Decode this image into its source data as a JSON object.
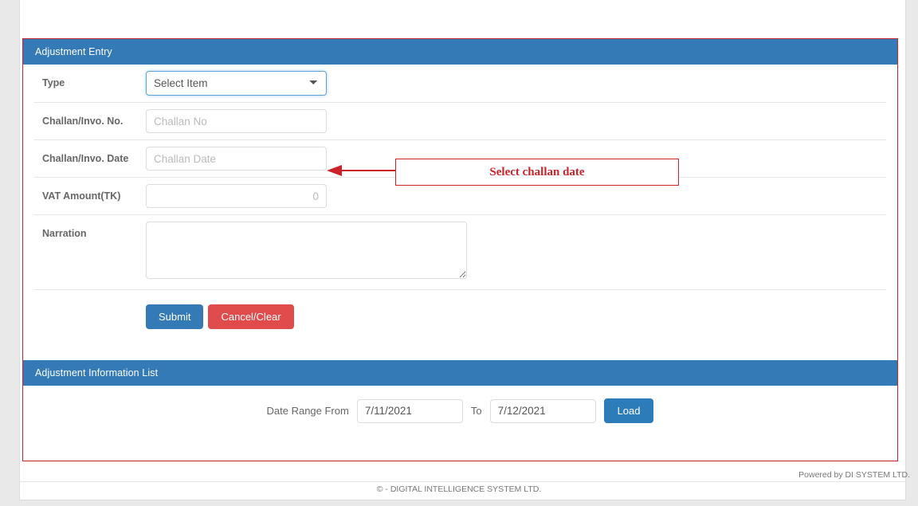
{
  "entry_panel": {
    "title": "Adjustment Entry",
    "fields": [
      {
        "label": "Type",
        "control": "select",
        "value": "Select Item",
        "icon": "chevron-down-icon"
      },
      {
        "label": "Challan/Invo. No.",
        "control": "text",
        "value": "",
        "placeholder": "Challan No"
      },
      {
        "label": "Challan/Invo. Date",
        "control": "text",
        "value": "",
        "placeholder": "Challan Date"
      },
      {
        "label": "VAT Amount(TK)",
        "control": "number",
        "value": "",
        "placeholder": "0"
      },
      {
        "label": "Narration",
        "control": "textarea",
        "value": "",
        "placeholder": ""
      }
    ],
    "submit_label": "Submit",
    "cancel_label": "Cancel/Clear"
  },
  "annotation": {
    "text": "Select challan date",
    "color": "#cc2229",
    "arrow": "arrow-left-icon"
  },
  "list_panel": {
    "title": "Adjustment Information List",
    "from_label": "Date Range From",
    "from_value": "7/11/2021",
    "to_label": "To",
    "to_value": "7/12/2021",
    "load_label": "Load"
  },
  "footer": {
    "powered_by": "Powered by DI SYSTEM LTD.",
    "copyright": "©  - DIGITAL INTELLIGENCE SYSTEM LTD."
  },
  "colors": {
    "panel_header": "#337ab7",
    "accent_red": "#cc2229",
    "danger": "#e04b4b"
  }
}
